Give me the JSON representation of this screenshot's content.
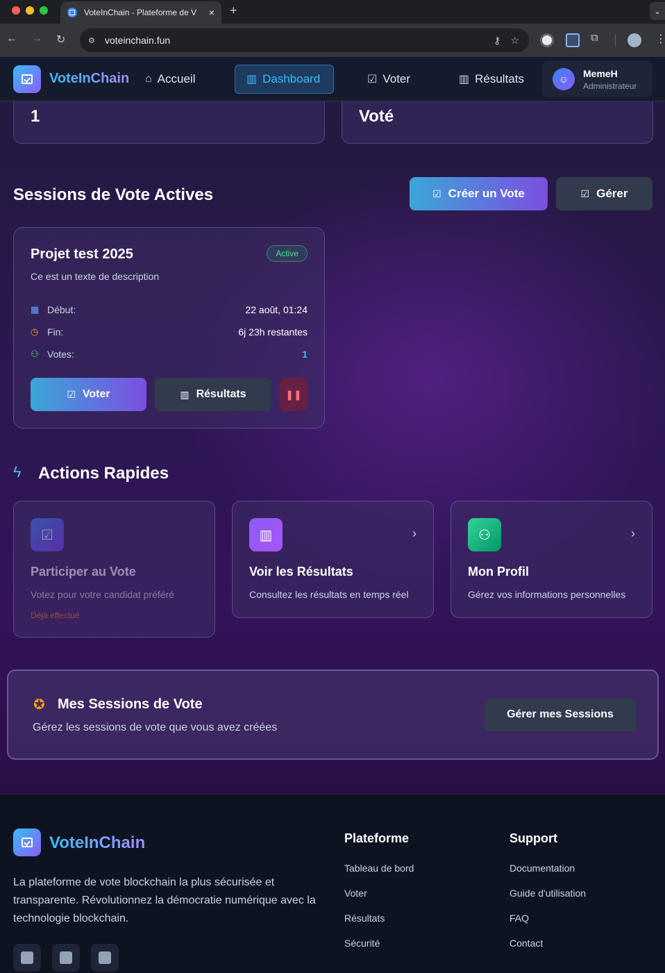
{
  "browser": {
    "tab_title": "VoteInChain - Plateforme de V",
    "tab_close": "×",
    "new_tab": "+",
    "tab_menu": "⌄",
    "url": "voteinchain.fun"
  },
  "nav": {
    "brand": "VoteInChain",
    "links": [
      {
        "label": "Accueil",
        "icon": "home-icon"
      },
      {
        "label": "Dashboard",
        "icon": "bar-chart-icon"
      },
      {
        "label": "Voter",
        "icon": "ballot-icon"
      },
      {
        "label": "Résultats",
        "icon": "bar-chart-icon"
      }
    ],
    "user": {
      "name": "MemeH",
      "role": "Administrateur"
    }
  },
  "stats": [
    {
      "value": "1"
    },
    {
      "value": "Voté"
    }
  ],
  "sessions_section": {
    "title": "Sessions de Vote Actives",
    "create_button": "Créer un Vote",
    "manage_button": "Gérer"
  },
  "session_card": {
    "title": "Projet test 2025",
    "status": "Active",
    "description": "Ce est un texte de description",
    "rows": [
      {
        "label": "Début:",
        "value": "22 août, 01:24",
        "icon": "calendar-icon"
      },
      {
        "label": "Fin:",
        "value": "6j 23h restantes",
        "icon": "clock-icon"
      },
      {
        "label": "Votes:",
        "value": "1",
        "icon": "users-icon"
      }
    ],
    "vote_button": "Voter",
    "results_button": "Résultats"
  },
  "quick_actions": {
    "title": "Actions Rapides",
    "cards": [
      {
        "title": "Participer au Vote",
        "description": "Votez pour votre candidat préféré",
        "note": "Déjà effectué"
      },
      {
        "title": "Voir les Résultats",
        "description": "Consultez les résultats en temps réel"
      },
      {
        "title": "Mon Profil",
        "description": "Gérez vos informations personnelles"
      }
    ]
  },
  "my_sessions": {
    "title": "Mes Sessions de Vote",
    "description": "Gérez les sessions de vote que vous avez créées",
    "button": "Gérer mes Sessions"
  },
  "footer": {
    "brand": "VoteInChain",
    "description": "La plateforme de vote blockchain la plus sécurisée et transparente. Révolutionnez la démocratie numérique avec la technologie blockchain.",
    "platform": {
      "title": "Plateforme",
      "links": [
        "Tableau de bord",
        "Voter",
        "Résultats",
        "Sécurité"
      ]
    },
    "support": {
      "title": "Support",
      "links": [
        "Documentation",
        "Guide d'utilisation",
        "FAQ",
        "Contact"
      ]
    }
  },
  "colors": {
    "accent_blue": "#38bdf8",
    "accent_purple": "#8b5cf6",
    "status_active": "#4ade80",
    "warning": "#f97316"
  }
}
